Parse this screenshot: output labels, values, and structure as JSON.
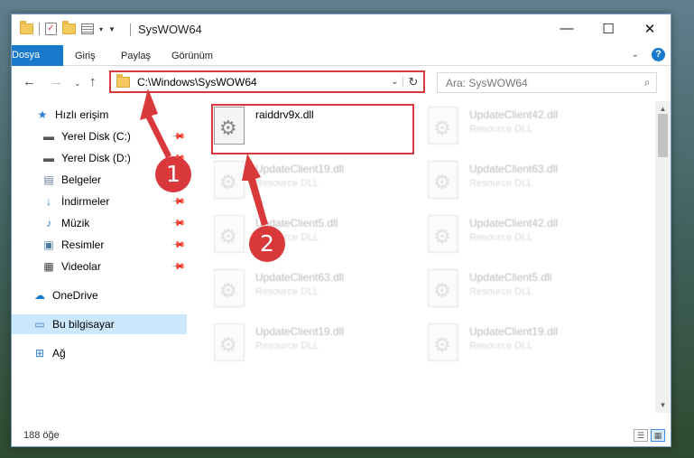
{
  "window": {
    "title": "SysWOW64"
  },
  "ribbon": {
    "tabs": [
      "Dosya",
      "Giriş",
      "Paylaş",
      "Görünüm"
    ]
  },
  "address": {
    "path": "C:\\Windows\\SysWOW64"
  },
  "search": {
    "placeholder": "Ara: SysWOW64"
  },
  "sidebar": {
    "items": [
      {
        "label": "Hızlı erişim",
        "icon": "star-icon"
      },
      {
        "label": "Yerel Disk (C:)",
        "icon": "drive-icon",
        "pinned": true
      },
      {
        "label": "Yerel Disk (D:)",
        "icon": "drive-icon",
        "pinned": true
      },
      {
        "label": "Belgeler",
        "icon": "documents-icon",
        "pinned": true
      },
      {
        "label": "İndirmeler",
        "icon": "download-icon",
        "pinned": true
      },
      {
        "label": "Müzik",
        "icon": "music-icon",
        "pinned": true
      },
      {
        "label": "Resimler",
        "icon": "pictures-icon",
        "pinned": true
      },
      {
        "label": "Videolar",
        "icon": "videos-icon",
        "pinned": true
      },
      {
        "label": "OneDrive",
        "icon": "cloud-icon"
      },
      {
        "label": "Bu bilgisayar",
        "icon": "computer-icon",
        "selected": true
      },
      {
        "label": "Ağ",
        "icon": "network-icon"
      }
    ]
  },
  "files": [
    {
      "name": "raiddrv9x.dll",
      "type": ""
    },
    {
      "name": "UpdateClient42.dll",
      "type": "Resource DLL"
    },
    {
      "name": "UpdateClient19.dll",
      "type": "Resource DLL"
    },
    {
      "name": "UpdateClient63.dll",
      "type": "Resource DLL"
    },
    {
      "name": "UpdateClient5.dll",
      "type": "Resource DLL"
    },
    {
      "name": "UpdateClient42.dll",
      "type": "Resource DLL"
    },
    {
      "name": "UpdateClient63.dll",
      "type": "Resource DLL"
    },
    {
      "name": "UpdateClient5.dll",
      "type": "Resource DLL"
    },
    {
      "name": "UpdateClient19.dll",
      "type": "Resource DLL"
    },
    {
      "name": "UpdateClient19.dll",
      "type": "Resource DLL"
    }
  ],
  "status": {
    "item_count": "188 öğe"
  },
  "callouts": [
    "1",
    "2"
  ],
  "colors": {
    "accent": "#1979ca",
    "highlight": "#d9393b",
    "selected": "#cce8ff"
  }
}
